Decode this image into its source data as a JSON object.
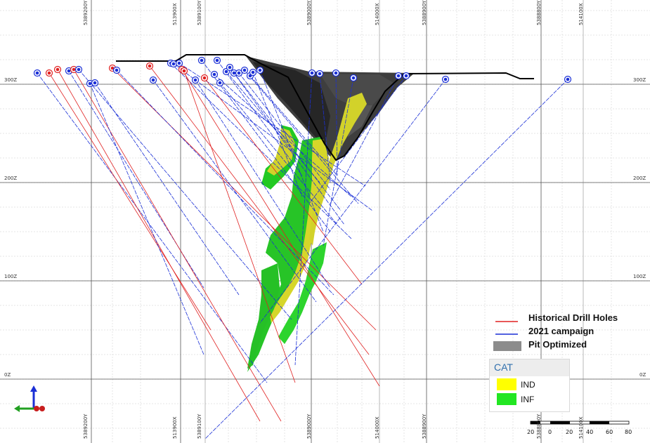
{
  "grid": {
    "top_labels": [
      "5389200Y",
      "513900X",
      "5389100Y",
      "5389000Y",
      "514000X",
      "5388900Y",
      "5388800Y",
      "514100X"
    ],
    "bottom_labels": [
      "5389200Y",
      "513900X",
      "5389100Y",
      "5389000Y",
      "514000X",
      "5388900Y",
      "5388800Y",
      "514100X"
    ],
    "elevation_labels": [
      "300Z",
      "200Z",
      "100Z",
      "0Z"
    ]
  },
  "legend": {
    "historical_label": "Historical Drill Holes",
    "historical_color": "#e02020",
    "campaign_label": "2021 campaign",
    "campaign_color": "#1a2fd6",
    "pit_label": "Pit Optimized",
    "pit_color": "#8c8c8c"
  },
  "cat": {
    "title": "CAT",
    "items": [
      {
        "label": "IND",
        "color": "#ffff00"
      },
      {
        "label": "INF",
        "color": "#22e622"
      }
    ]
  },
  "scale_bar": {
    "ticks": [
      "20",
      "0",
      "20",
      "40",
      "60",
      "80"
    ]
  },
  "colors": {
    "orebody_yellow": "#d9d92e",
    "orebody_green": "#2ecc2e",
    "pit_dark": "#3c3c3c",
    "grid_major": "#444444",
    "grid_minor": "#d8d8d8"
  }
}
